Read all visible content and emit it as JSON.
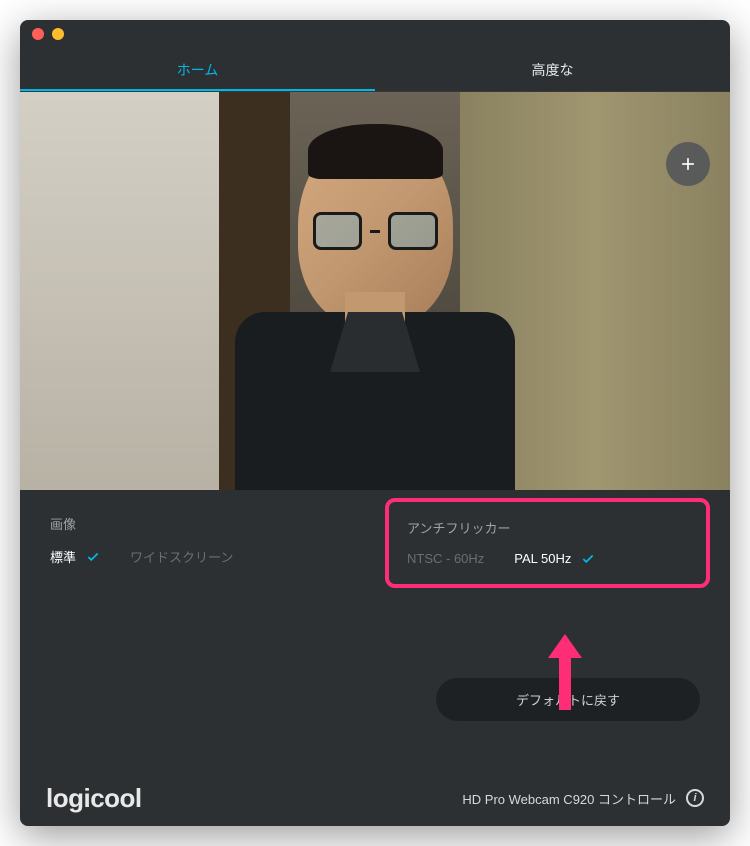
{
  "tabs": {
    "home": "ホーム",
    "advanced": "高度な"
  },
  "image_group": {
    "label": "画像",
    "standard": "標準",
    "widescreen": "ワイドスクリーン"
  },
  "antiflicker": {
    "label": "アンチフリッカー",
    "ntsc": "NTSC - 60Hz",
    "pal": "PAL 50Hz"
  },
  "reset": "デフォルトに戻す",
  "brand": "logicool",
  "device": "HD Pro Webcam C920 コントロール",
  "icons": {
    "plus": "plus-icon",
    "check": "check-icon",
    "info": "info-icon"
  }
}
